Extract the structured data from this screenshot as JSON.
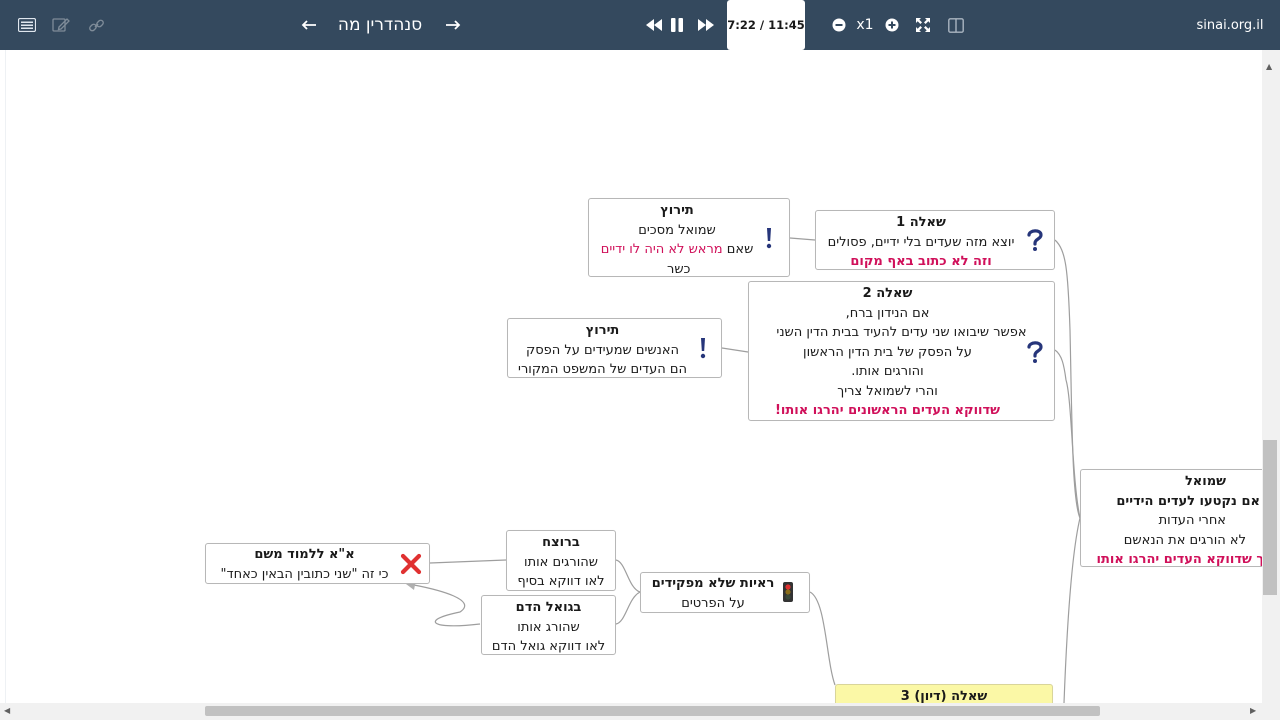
{
  "toolbar": {
    "title": "סנהדרין מה",
    "time": "7:22 / 11:45",
    "speed": "x1",
    "site": "sinai.org.il",
    "icons": [
      "menu-icon",
      "edit-icon",
      "link-icon",
      "arrow-left-icon",
      "arrow-right-icon",
      "rewind-icon",
      "pause-icon",
      "fast-forward-icon",
      "minus-circle-icon",
      "plus-circle-icon",
      "fullscreen-icon",
      "split-view-icon"
    ]
  },
  "colors": {
    "toolbar": "#34495e",
    "highlight": "#d0105a",
    "node_border": "#b7b7b7",
    "yellow_node": "#fbf8a6"
  },
  "nodes": {
    "question1": {
      "title": "שאלה 1",
      "line1": "יוצא מזה שעדים בלי ידיים, פסולים",
      "line2": "וזה לא כתוב באף מקום"
    },
    "answer1": {
      "title": "תירוץ",
      "line1": "שמואל מסכים",
      "line2_plain": "שאם ",
      "line2_red": "מראש לא היה לו ידיים",
      "line3": "כשר"
    },
    "question2": {
      "title": "שאלה 2",
      "line1": "אם הנידון ברח,",
      "line2": "אפשר שיבואו שני עדים להעיד בבית הדין השני",
      "line3": "על הפסק של בית הדין הראשון",
      "line4": "והורגים אותו.",
      "line5": "והרי לשמואל צריך",
      "line6": "שדווקא העדים הראשונים יהרגו אותו!"
    },
    "answer2": {
      "title": "תירוץ",
      "line1": "האנשים שמעידים על הפסק",
      "line2": "הם העדים של המשפט המקורי"
    },
    "shmuel": {
      "title": "שמואל",
      "line1": "אם נקטעו לעדים הידיים",
      "line2": "אחרי העדות",
      "line3": "לא הורגים את הנאשם",
      "line4": "צריך שדווקא העדים יהרגו אותו"
    },
    "proofs": {
      "title": "ראיות שלא מפקידים",
      "line1": "על הפרטים"
    },
    "murderer": {
      "title": "ברוצח",
      "line1": "שהורגים אותו",
      "line2": "לאו דווקא בסיף"
    },
    "avenger": {
      "title": "בגואל הדם",
      "line1": "שהורג אותו",
      "line2": "לאו דווקא גואל הדם"
    },
    "refuted": {
      "title": "א\"א ללמוד משם",
      "line1": "כי זה \"שני כתובין הבאין כאחד\""
    },
    "question3": {
      "title": "שאלה (דיון) 3"
    }
  }
}
